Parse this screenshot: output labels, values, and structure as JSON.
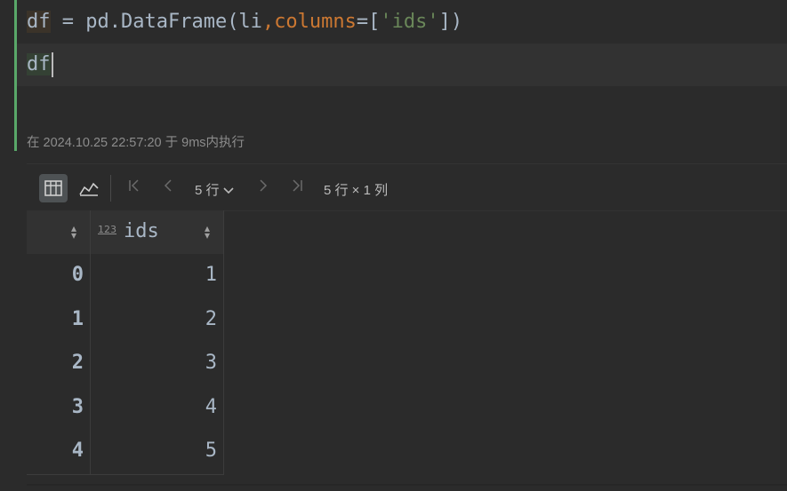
{
  "code": {
    "line1": {
      "var": "df",
      "eq": " = ",
      "call": "pd.DataFrame(li",
      "comma": ",",
      "param": "columns",
      "assign": "=[",
      "str": "'ids'",
      "close": "])"
    },
    "line2": {
      "text": "df"
    }
  },
  "exec_info": "在 2024.10.25 22:57:20 于 9ms内执行",
  "toolbar": {
    "table_view_icon": "table-icon",
    "chart_view_icon": "chart-icon",
    "first_page": "|<",
    "prev_page": "<",
    "rows_select": "5 行",
    "next_page": ">",
    "last_page": ">|",
    "shape": "5 行 × 1 列"
  },
  "table": {
    "column_type": "123",
    "column_name": "ids",
    "rows": [
      {
        "index": "0",
        "value": "1"
      },
      {
        "index": "1",
        "value": "2"
      },
      {
        "index": "2",
        "value": "3"
      },
      {
        "index": "3",
        "value": "4"
      },
      {
        "index": "4",
        "value": "5"
      }
    ]
  }
}
